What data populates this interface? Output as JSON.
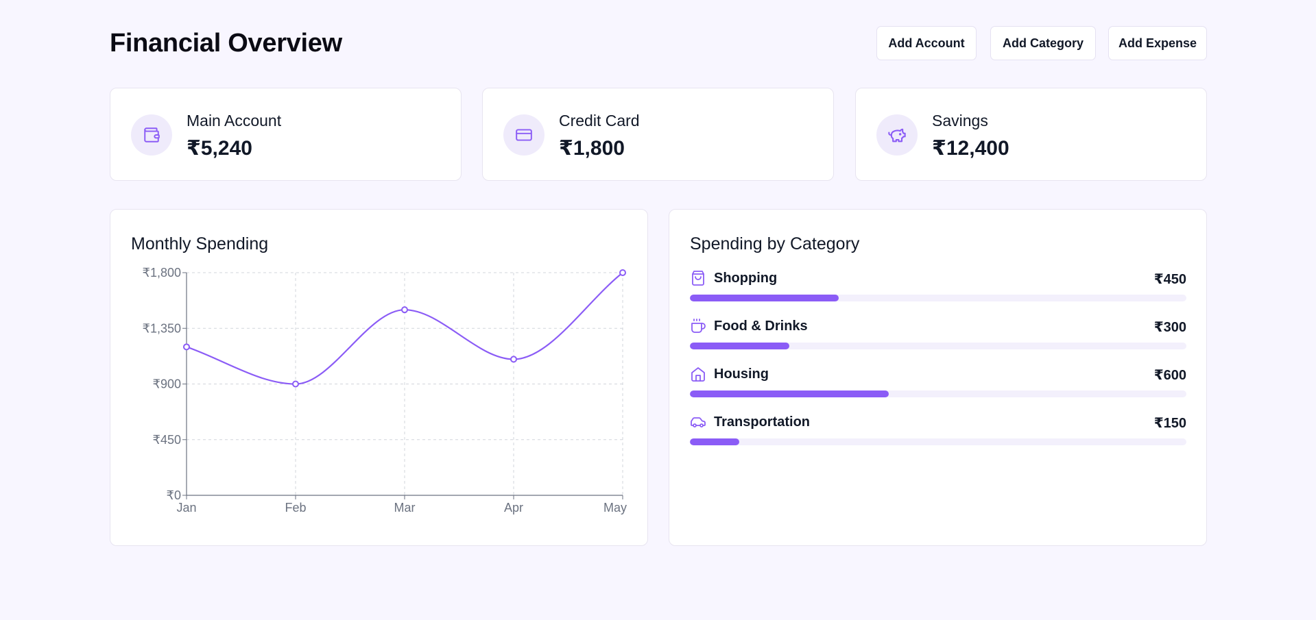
{
  "page": {
    "title": "Financial Overview"
  },
  "toolbar": {
    "add_account_label": "Add Account",
    "add_category_label": "Add Category",
    "add_expense_label": "Add Expense"
  },
  "accounts": [
    {
      "name": "Main Account",
      "balance": "₹5,240",
      "icon": "wallet-icon"
    },
    {
      "name": "Credit Card",
      "balance": "₹1,800",
      "icon": "credit-card-icon"
    },
    {
      "name": "Savings",
      "balance": "₹12,400",
      "icon": "piggy-bank-icon"
    }
  ],
  "monthly_spending": {
    "title": "Monthly Spending"
  },
  "chart_data": {
    "type": "line",
    "title": "Monthly Spending",
    "categories": [
      "Jan",
      "Feb",
      "Mar",
      "Apr",
      "May"
    ],
    "values": [
      1200,
      900,
      1500,
      1100,
      1800
    ],
    "ylim": [
      0,
      1800
    ],
    "yticks": [
      0,
      450,
      900,
      1350,
      1800
    ],
    "ytick_labels": [
      "₹0",
      "₹450",
      "₹900",
      "₹1,350",
      "₹1,800"
    ],
    "grid": true,
    "color": "#8b5cf6"
  },
  "spending_by_category": {
    "title": "Spending by Category",
    "max_value": 1500,
    "items": [
      {
        "name": "Shopping",
        "amount": "₹450",
        "value": 450,
        "icon": "shopping-bag-icon"
      },
      {
        "name": "Food & Drinks",
        "amount": "₹300",
        "value": 300,
        "icon": "coffee-icon"
      },
      {
        "name": "Housing",
        "amount": "₹600",
        "value": 600,
        "icon": "home-icon"
      },
      {
        "name": "Transportation",
        "amount": "₹150",
        "value": 150,
        "icon": "car-icon"
      }
    ]
  },
  "colors": {
    "accent": "#8b5cf6",
    "accent_light": "#efebfb",
    "background": "#f8f6ff"
  }
}
